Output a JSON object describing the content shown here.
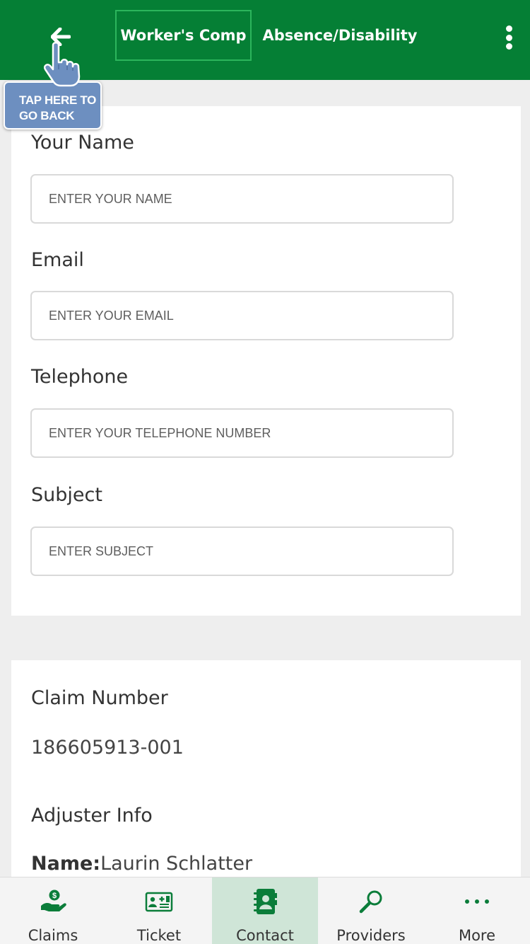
{
  "header": {
    "tabs": [
      {
        "label": "Worker's Comp",
        "active": true
      },
      {
        "label": "Absence/Disability",
        "active": false
      }
    ],
    "back_icon": "arrow-left-icon",
    "menu_icon": "kebab-menu-icon"
  },
  "tooltip": {
    "line1": "TAP HERE TO",
    "line2": "GO BACK",
    "icon": "pointing-hand-icon"
  },
  "form": {
    "fields": [
      {
        "label": "Your Name",
        "placeholder": "ENTER YOUR NAME",
        "value": ""
      },
      {
        "label": "Email",
        "placeholder": "ENTER YOUR EMAIL",
        "value": ""
      },
      {
        "label": "Telephone",
        "placeholder": "ENTER YOUR TELEPHONE NUMBER",
        "value": ""
      },
      {
        "label": "Subject",
        "placeholder": "ENTER SUBJECT",
        "value": ""
      }
    ]
  },
  "claim": {
    "number_label": "Claim Number",
    "number_value": "186605913-001",
    "adjuster_label": "Adjuster Info",
    "name_label": "Name:",
    "name_value": "Laurin Schlatter"
  },
  "bottom_nav": {
    "items": [
      {
        "label": "Claims",
        "icon": "hand-money-icon",
        "active": false
      },
      {
        "label": "Ticket",
        "icon": "id-card-icon",
        "active": false
      },
      {
        "label": "Contact",
        "icon": "contact-book-icon",
        "active": true
      },
      {
        "label": "Providers",
        "icon": "search-icon",
        "active": false
      },
      {
        "label": "More",
        "icon": "more-dots-icon",
        "active": false
      }
    ]
  },
  "colors": {
    "primary": "#057f35",
    "active_tab_border": "#2cb55c",
    "tooltip_bg": "#6d8fc0",
    "nav_active_bg": "#cfe5d7",
    "page_bg": "#eeeeee"
  }
}
